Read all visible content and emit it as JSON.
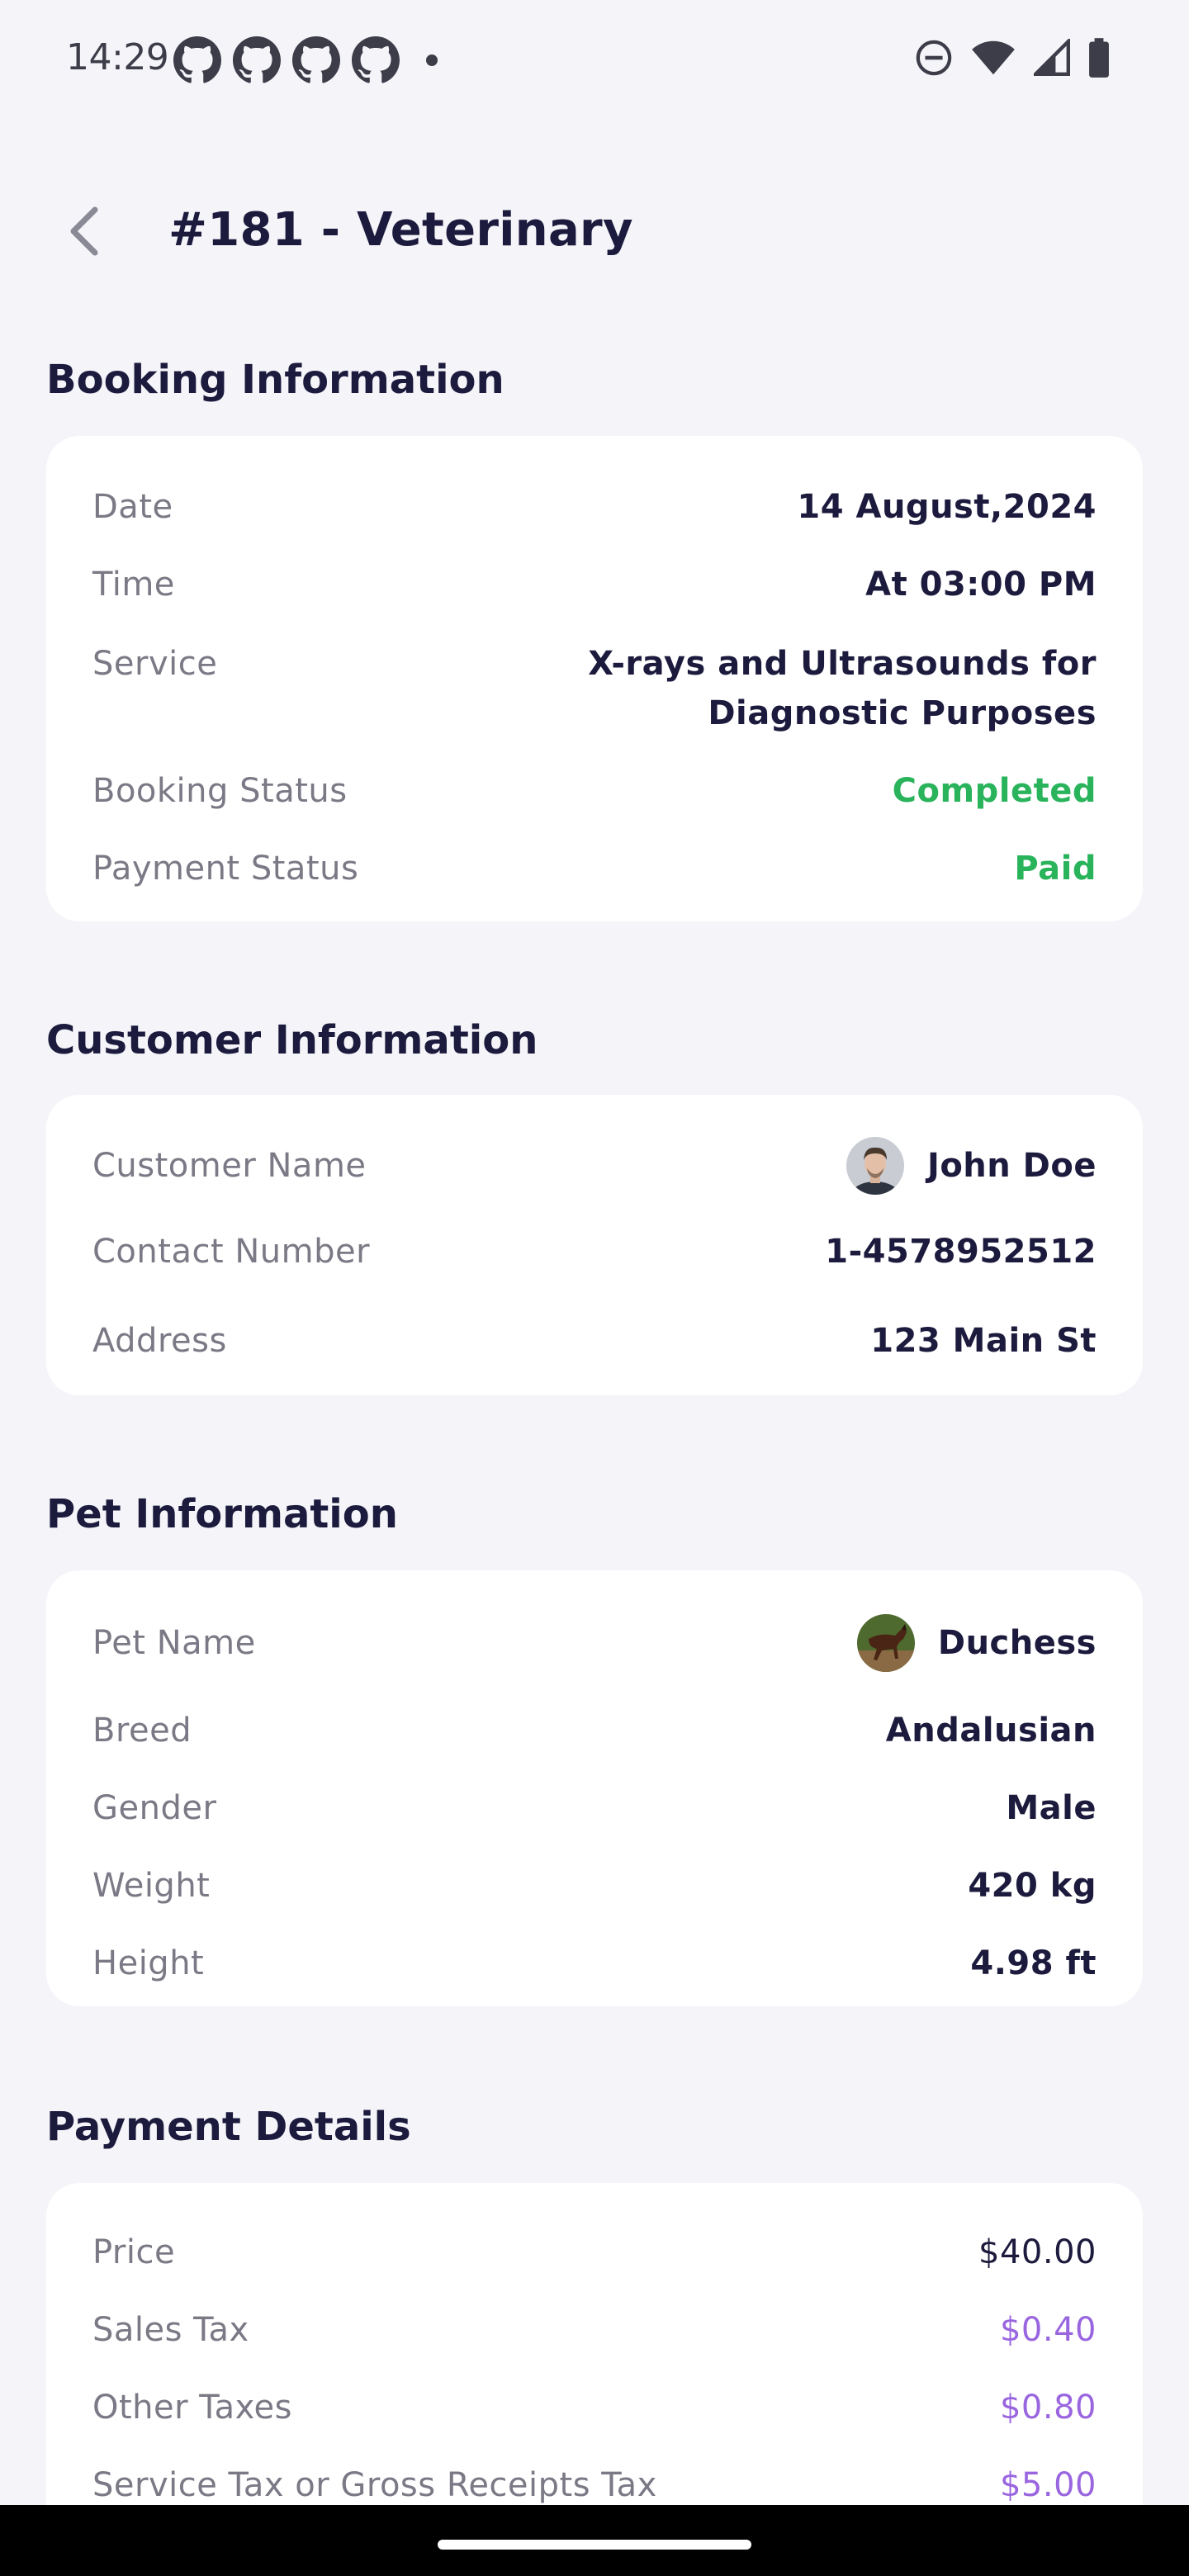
{
  "status_bar": {
    "time": "14:29",
    "notification_icons": [
      "github-icon",
      "github-icon",
      "github-icon",
      "github-icon",
      "dot-icon"
    ],
    "system_icons": [
      "do-not-disturb-icon",
      "wifi-icon",
      "cellular-signal-icon",
      "battery-icon"
    ]
  },
  "header": {
    "back_icon": "chevron-left-icon",
    "title": "#181 - Veterinary"
  },
  "booking": {
    "title": "Booking Information",
    "date_label": "Date",
    "date_value": "14 August,2024",
    "time_label": "Time",
    "time_value": "At 03:00 PM",
    "service_label": "Service",
    "service_value_line1": "X-rays and Ultrasounds for",
    "service_value_line2": "Diagnostic Purposes",
    "status_label": "Booking Status",
    "status_value": "Completed",
    "payment_status_label": "Payment Status",
    "payment_status_value": "Paid"
  },
  "customer": {
    "title": "Customer Information",
    "name_label": "Customer Name",
    "name_value": "John Doe",
    "contact_label": "Contact Number",
    "contact_value": "1-4578952512",
    "address_label": "Address",
    "address_value": "123 Main St"
  },
  "pet": {
    "title": "Pet Information",
    "name_label": "Pet Name",
    "name_value": "Duchess",
    "breed_label": "Breed",
    "breed_value": "Andalusian",
    "gender_label": "Gender",
    "gender_value": "Male",
    "weight_label": "Weight",
    "weight_value": "420 kg",
    "height_label": "Height",
    "height_value": "4.98 ft"
  },
  "payment": {
    "title": "Payment Details",
    "price_label": "Price",
    "price_value": "$40.00",
    "sales_tax_label": "Sales Tax",
    "sales_tax_value": "$0.40",
    "other_taxes_label": "Other Taxes",
    "other_taxes_value": "$0.80",
    "service_tax_label": "Service Tax or Gross Receipts Tax",
    "service_tax_value": "$5.00"
  },
  "colors": {
    "background": "#f4f4f9",
    "card": "#ffffff",
    "text_primary": "#1c1a3d",
    "text_label": "#7a7985",
    "status_green": "#29b35b",
    "tax_purple": "#9a66e0"
  }
}
